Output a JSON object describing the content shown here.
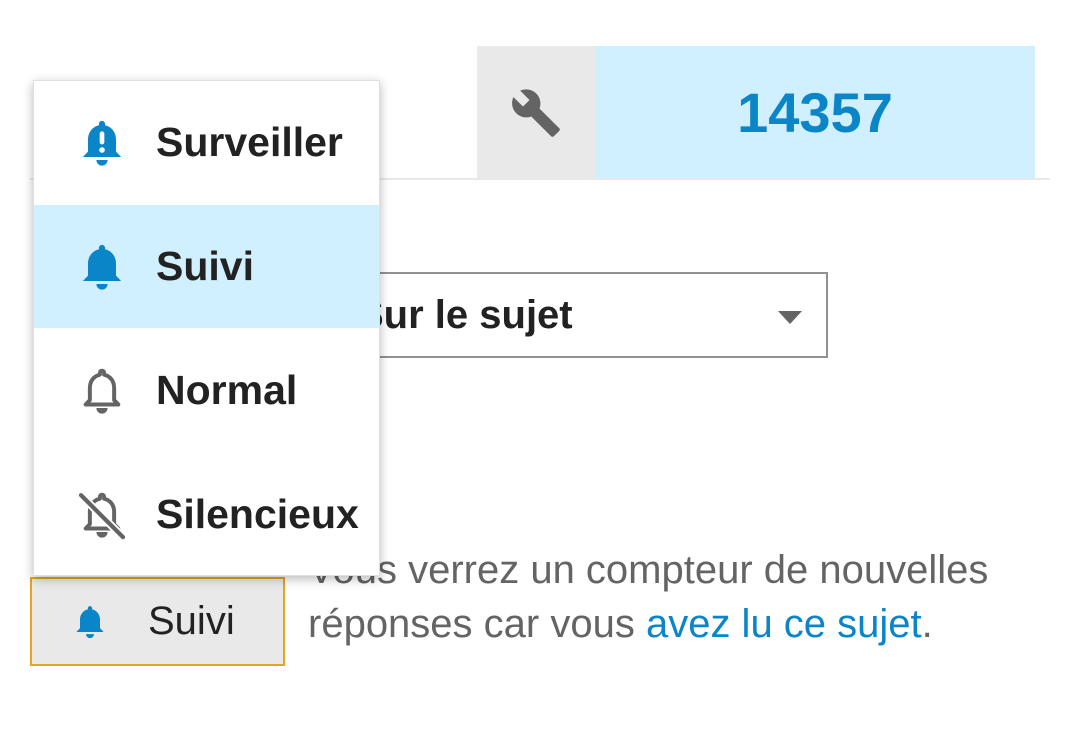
{
  "topic_admin": {
    "icon": "wrench-icon"
  },
  "reply_count": {
    "value": "14357"
  },
  "topic_select": {
    "label": "Sur le sujet"
  },
  "notifications": {
    "current": "Suivi",
    "description_text": "Vous verrez un compteur de nouvelles réponses car vous ",
    "description_link": "avez lu ce sujet",
    "description_end": ".",
    "menu": [
      {
        "label": "Surveiller",
        "icon": "bell-exclamation-icon",
        "selected": false
      },
      {
        "label": "Suivi",
        "icon": "bell-filled-icon",
        "selected": true
      },
      {
        "label": "Normal",
        "icon": "bell-outline-icon",
        "selected": false
      },
      {
        "label": "Silencieux",
        "icon": "bell-slash-icon",
        "selected": false
      }
    ]
  },
  "colors": {
    "accent": "#0a85c8",
    "highlight": "#d1f0ff",
    "button_bg": "#e9e9e9",
    "focus_border": "#e5a521",
    "muted_text": "#646464"
  }
}
